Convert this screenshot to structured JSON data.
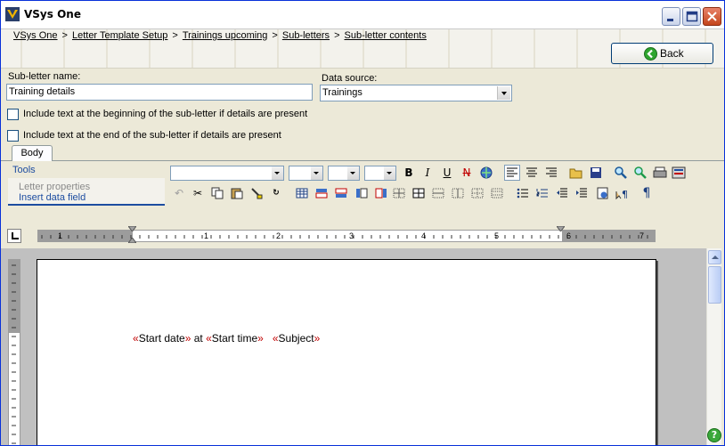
{
  "window": {
    "title": "VSys One"
  },
  "breadcrumb": [
    "VSys One",
    "Letter Template Setup",
    "Trainings upcoming",
    "Sub-letters",
    "Sub-letter contents"
  ],
  "breadcrumb_separator": ">",
  "header": {
    "back_label": "Back"
  },
  "form": {
    "name_label": "Sub-letter name:",
    "name_value": "Training details",
    "source_label": "Data source:",
    "source_value": "Trainings",
    "check_begin_label": "Include text at the beginning of the sub-letter if details are present",
    "check_end_label": "Include text at the end of the sub-letter if details are present"
  },
  "tabs": [
    {
      "label": "Body",
      "active": true
    }
  ],
  "tools": {
    "title": "Tools",
    "items": [
      {
        "label": "Letter properties",
        "enabled": false
      },
      {
        "label": "Insert data field",
        "enabled": true
      }
    ]
  },
  "toolbar": {
    "bold": "B",
    "italic": "I",
    "underline": "U",
    "strike": "N",
    "pilcrow": "¶"
  },
  "ruler": {
    "numbers": [
      "1",
      "1",
      "2",
      "3",
      "4",
      "5",
      "6",
      "7"
    ]
  },
  "document": {
    "fields": [
      {
        "open": "«",
        "name": "Start date",
        "close": "»"
      },
      {
        "open": "«",
        "name": "Start time",
        "close": "»"
      },
      {
        "open": "«",
        "name": "Subject",
        "close": "»"
      }
    ],
    "connector": "at"
  },
  "colors": {
    "accent": "#1c4ca0",
    "field_marker": "#c00000",
    "window_bg": "#ece9d8"
  }
}
